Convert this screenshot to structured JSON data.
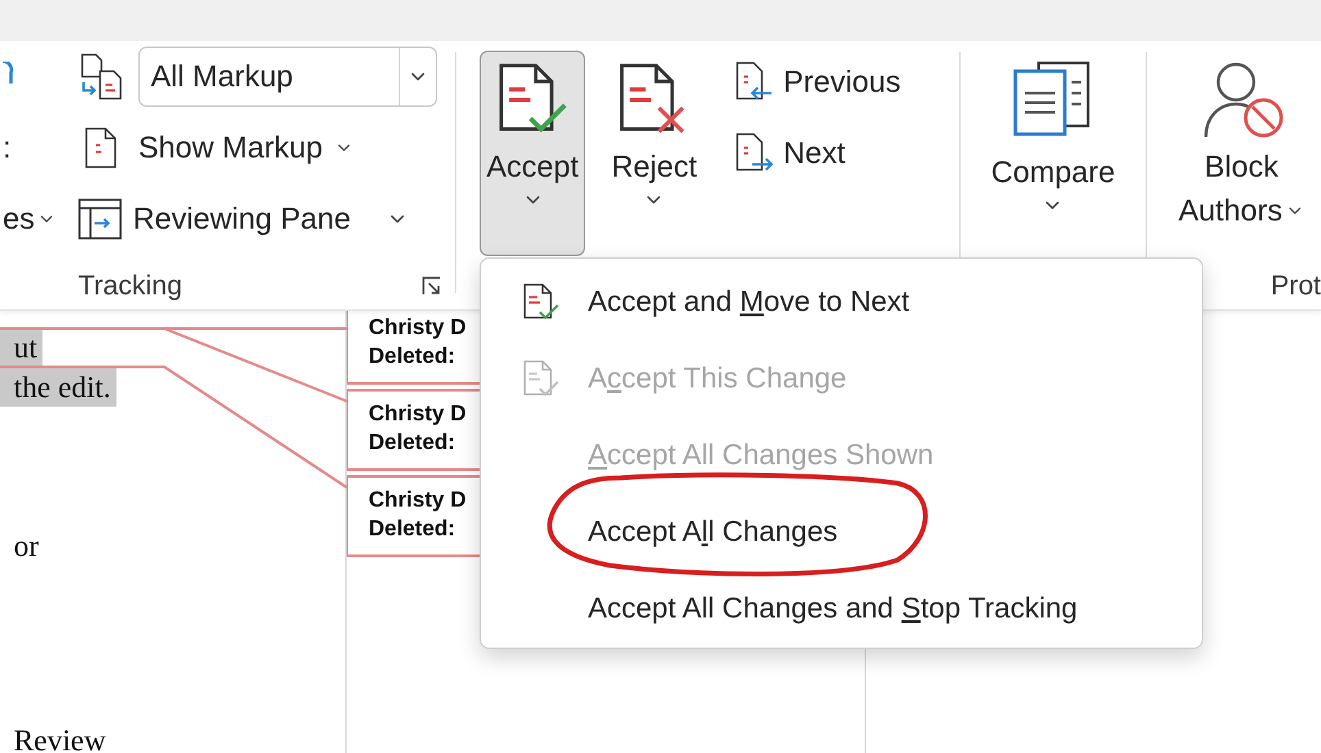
{
  "ribbon": {
    "partial_group": {
      "texts": [
        ":",
        "es"
      ]
    },
    "tracking": {
      "display_dropdown": {
        "value": "All Markup"
      },
      "show_markup": "Show Markup",
      "reviewing_pane": "Reviewing Pane",
      "label": "Tracking"
    },
    "changes": {
      "accept": {
        "label": "Accept",
        "expanded": true
      },
      "reject": {
        "label": "Reject"
      },
      "previous": "Previous",
      "next": "Next"
    },
    "compare": {
      "label": "Compare"
    },
    "protect": {
      "block_line1": "Block",
      "block_line2": "Authors",
      "label": "Prot"
    }
  },
  "document": {
    "paragraphs": [
      {
        "lines": [
          "ut",
          "the edit."
        ],
        "highlighted": true
      },
      {
        "lines": [
          "or"
        ],
        "highlighted": false
      },
      {
        "lines": [
          "Review"
        ],
        "highlighted": false
      }
    ]
  },
  "balloons": [
    {
      "author": "Christy D",
      "action": "Deleted:"
    },
    {
      "author": "Christy D",
      "action": "Deleted:"
    },
    {
      "author": "Christy D",
      "action": "Deleted:"
    }
  ],
  "accept_menu": {
    "items": [
      {
        "kind": "icon",
        "before": "Accept and ",
        "key": "M",
        "after": "ove to Next",
        "disabled": false,
        "circled": false
      },
      {
        "kind": "icon",
        "before": "A",
        "key": "c",
        "after": "cept This Change",
        "disabled": true,
        "circled": false
      },
      {
        "kind": "plain",
        "key": "A",
        "after": "ccept All Changes Shown",
        "disabled": true,
        "circled": false
      },
      {
        "kind": "plain",
        "before": "Accept A",
        "key": "l",
        "after": "l Changes",
        "disabled": false,
        "circled": true
      },
      {
        "kind": "plain",
        "before": "Accept All Changes and ",
        "key": "S",
        "after": "top Tracking",
        "disabled": false,
        "circled": false
      }
    ]
  }
}
